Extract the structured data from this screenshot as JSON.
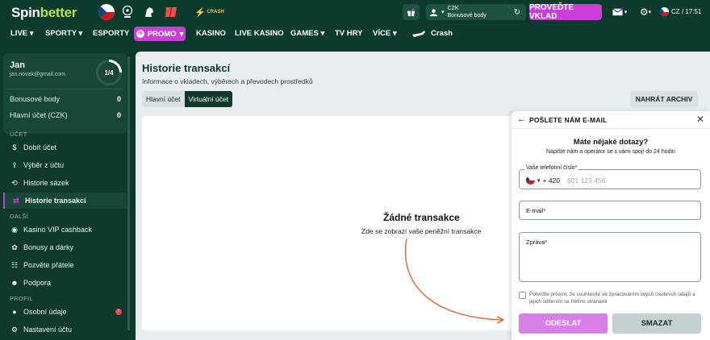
{
  "brand": {
    "part1": "Spin",
    "part2": "better"
  },
  "topbar": {
    "account": {
      "currency": "CZK",
      "bonus_label": "Bonusové body",
      "balance": "0",
      "bonus": "0"
    },
    "deposit_label": "PROVEĎTE VKLAD",
    "lang_time": "CZ / 17:51",
    "crash_badge": "CRASH"
  },
  "nav": {
    "live": "LIVE",
    "sports": "SPORTY",
    "esports": "ESPORTY",
    "promo": "PROMO",
    "casino": "KASINO",
    "live_casino": "LIVE KASINO",
    "games": "GAMES",
    "tv_games": "TV HRY",
    "more": "VÍCE",
    "crash": "Crash"
  },
  "sidebar": {
    "user": {
      "name": "Jan",
      "email": "jan.novak@gmail.com",
      "level": "1/4"
    },
    "bonus_points": {
      "label": "Bonusové body",
      "value": "0"
    },
    "main_account": {
      "label": "Hlavní účet (CZK)",
      "value": "0"
    },
    "sections": {
      "account": "ÚČET",
      "other": "DALŠÍ",
      "profile": "PROFIL"
    },
    "account_items": [
      "Dobít účet",
      "Výběr z účtu",
      "Historie sázek",
      "Historie transakcí"
    ],
    "other_items": [
      "Kasino VIP cashback",
      "Bonusy a dárky",
      "Pozvěte přátele",
      "Podpora"
    ],
    "profile_items": [
      "Osobní údaje",
      "Nastavení účtu"
    ],
    "personal_badge": "!"
  },
  "main": {
    "title": "Historie transakcí",
    "subtitle": "Informace o vkladech, výběrech a převodech prostředků",
    "tabs": [
      "Hlavní účet",
      "Virtuální účet"
    ],
    "archive_button": "NAHRÁT ARCHIV",
    "empty_title": "Žádné transakce",
    "empty_subtitle": "Zde se zobrazí vaše peněžní transakce"
  },
  "widget": {
    "title": "POŠLETE NÁM E-MAIL",
    "question": "Máte nějaké dotazy?",
    "description": "Napište nám a operátor se s vámi spojí do 24 hodin",
    "phone_label": "Vaše telefonní číslo*",
    "phone_prefix": "+ 420",
    "phone_placeholder": "601 123 456",
    "email_label": "E-mail*",
    "message_label": "Zpráva*",
    "consent": "Potvrďte prosím, že souhlasíte se zpracováním svých osobních údajů a jejich sdílením se třetími stranami",
    "send": "ODESLAT",
    "clear": "SMAZAT"
  },
  "colors": {
    "brand_green": "#0b3b2d",
    "accent_purple": "#c93fd6",
    "lime": "#b7e04a"
  }
}
